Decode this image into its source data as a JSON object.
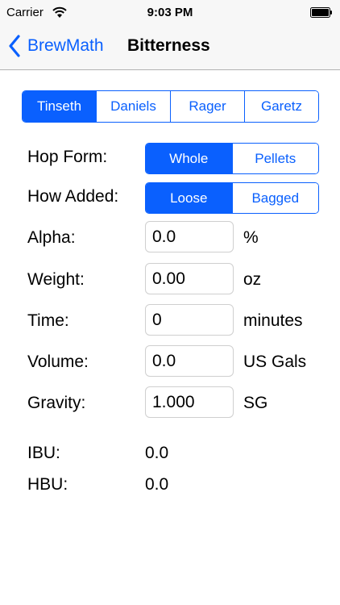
{
  "status_bar": {
    "carrier": "Carrier",
    "time": "9:03 PM"
  },
  "nav": {
    "back_label": "BrewMath",
    "title": "Bitterness"
  },
  "formula_segment": {
    "options": [
      "Tinseth",
      "Daniels",
      "Rager",
      "Garetz"
    ],
    "selected": "Tinseth"
  },
  "hop_form": {
    "label": "Hop Form:",
    "options": [
      "Whole",
      "Pellets"
    ],
    "selected": "Whole"
  },
  "how_added": {
    "label": "How Added:",
    "options": [
      "Loose",
      "Bagged"
    ],
    "selected": "Loose"
  },
  "inputs": [
    {
      "label": "Alpha:",
      "value": "0.0",
      "unit": "%"
    },
    {
      "label": "Weight:",
      "value": "0.00",
      "unit": "oz"
    },
    {
      "label": "Time:",
      "value": "0",
      "unit": "minutes"
    },
    {
      "label": "Volume:",
      "value": "0.0",
      "unit": "US Gals"
    },
    {
      "label": "Gravity:",
      "value": "1.000",
      "unit": "SG"
    }
  ],
  "results": [
    {
      "label": "IBU:",
      "value": "0.0"
    },
    {
      "label": "HBU:",
      "value": "0.0"
    }
  ],
  "colors": {
    "accent": "#0a60fe",
    "bar_background": "#f7f7f7"
  },
  "icons": {
    "wifi": "wifi-icon",
    "battery": "battery-icon",
    "back": "chevron-left-icon"
  }
}
